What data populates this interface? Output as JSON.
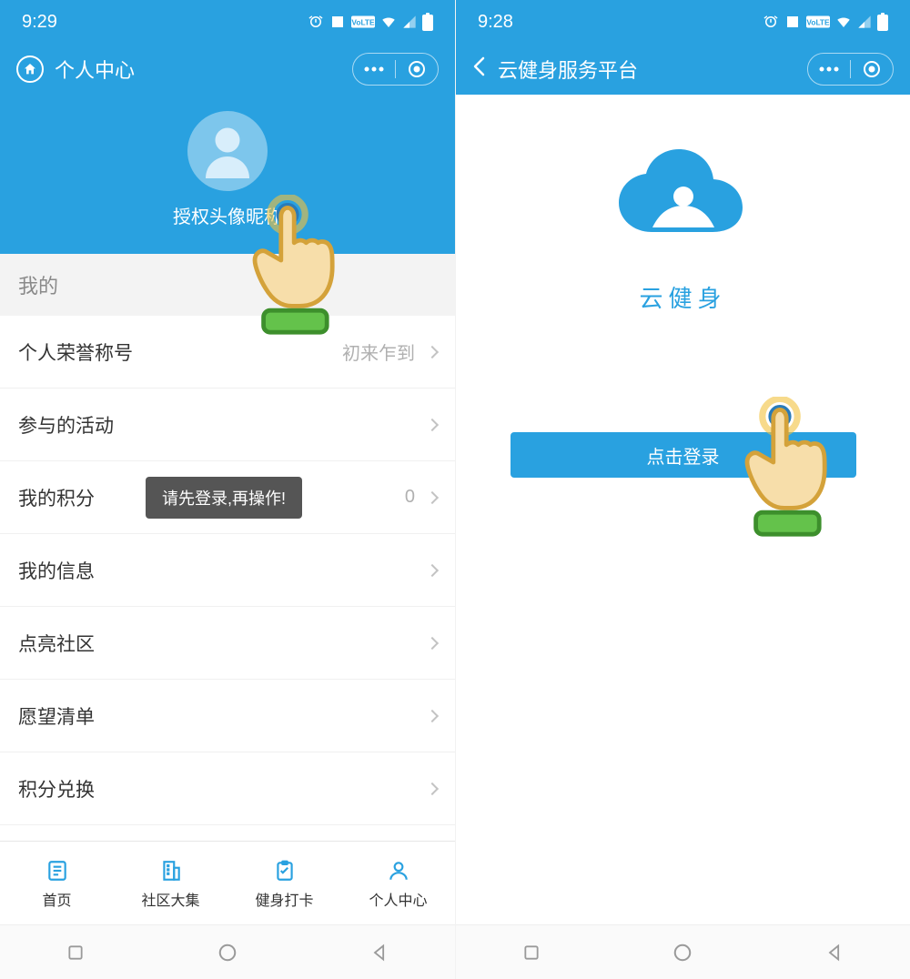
{
  "left": {
    "status": {
      "time": "9:29"
    },
    "titlebar": {
      "title": "个人中心"
    },
    "profile": {
      "nick_label": "授权头像昵称"
    },
    "section_header": "我的",
    "rows": [
      {
        "label": "个人荣誉称号",
        "value": "初来乍到"
      },
      {
        "label": "参与的活动",
        "value": ""
      },
      {
        "label": "我的积分",
        "value": "0",
        "toast": "请先登录,再操作!"
      },
      {
        "label": "我的信息",
        "value": ""
      },
      {
        "label": "点亮社区",
        "value": ""
      },
      {
        "label": "愿望清单",
        "value": ""
      },
      {
        "label": "积分兑换",
        "value": ""
      }
    ],
    "tabs": [
      {
        "label": "首页",
        "icon": "sheet-icon"
      },
      {
        "label": "社区大集",
        "icon": "building-icon"
      },
      {
        "label": "健身打卡",
        "icon": "clipboard-icon"
      },
      {
        "label": "个人中心",
        "icon": "person-icon"
      }
    ]
  },
  "right": {
    "status": {
      "time": "9:28"
    },
    "titlebar": {
      "title": "云健身服务平台"
    },
    "logo_caption": "云健身",
    "login_button": "点击登录"
  },
  "colors": {
    "primary": "#29a1e0"
  }
}
